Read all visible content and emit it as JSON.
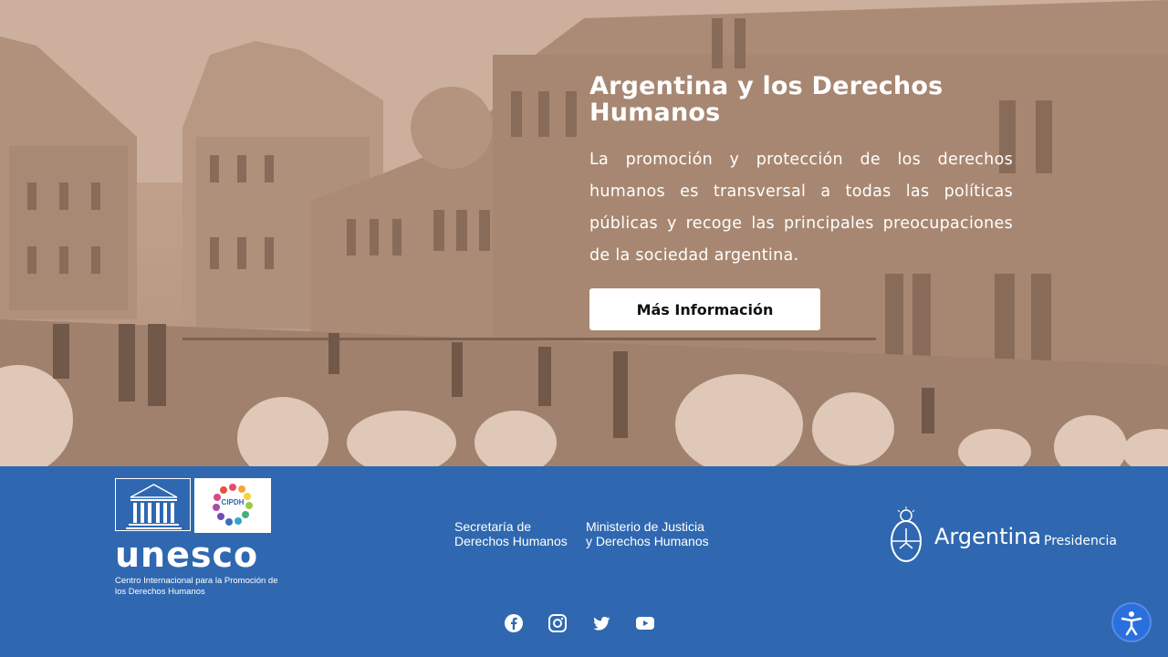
{
  "hero": {
    "title": "Argentina y los Derechos Humanos",
    "text": "La promoción y protección de los derechos humanos es transversal a todas las políticas públicas y recoge las principales preocupaciones de la sociedad argentina.",
    "cta_label": "Más Información"
  },
  "footer": {
    "unesco_word": "unesco",
    "unesco_subtitle": "Centro Internacional para la Promoción de los Derechos Humanos",
    "cipdh_label": "CIPDH",
    "unesco_emblem_text": "UNESCO",
    "secretaria": "Secretaría de\nDerechos Humanos",
    "ministerio": "Ministerio de Justicia\ny Derechos Humanos",
    "argentina": "Argentina",
    "presidencia": "Presidencia"
  },
  "social_icons": [
    "facebook-icon",
    "instagram-icon",
    "twitter-icon",
    "youtube-icon"
  ],
  "colors": {
    "footer_bg": "#2f68b0",
    "accessibility_bg": "#2a6fde",
    "hero_tint": "#b99a86"
  }
}
